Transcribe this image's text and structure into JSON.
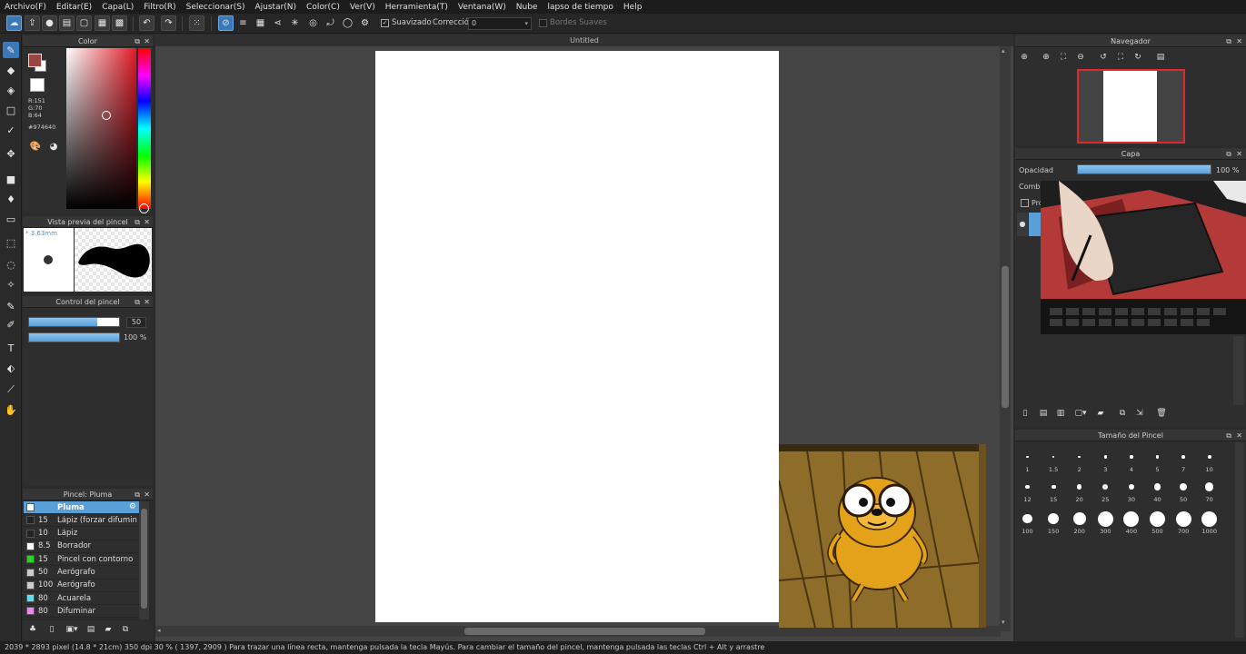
{
  "menu": [
    "Archivo(F)",
    "Editar(E)",
    "Capa(L)",
    "Filtro(R)",
    "Seleccionar(S)",
    "Ajustar(N)",
    "Color(C)",
    "Ver(V)",
    "Herramienta(T)",
    "Ventana(W)",
    "Nube",
    "lapso de tiempo",
    "Help"
  ],
  "toolbar": {
    "smoothing_label": "Suavizado",
    "correction_label": "Corrección",
    "correction_value": "0",
    "soft_edges_label": "Bordes Suaves"
  },
  "color_panel": {
    "title": "Color",
    "r": "R:151",
    "g": "G:70",
    "b": "B:64",
    "hex": "#974640",
    "main_color": "#974640"
  },
  "brush_preview": {
    "title": "Vista previa del pincel",
    "size": "* 3.63mm"
  },
  "brush_control": {
    "title": "Control del pincel",
    "size_value": "50",
    "size_fraction": 0.76,
    "opacity_value": "100 %",
    "opacity_fraction": 1.0
  },
  "brush_list": {
    "title": "Pincel: Pluma",
    "items": [
      {
        "size": "",
        "name": "Pluma",
        "color": "#ffffff",
        "selected": true
      },
      {
        "size": "15",
        "name": "Lápiz (forzar difuminado)",
        "color": "#222222"
      },
      {
        "size": "10",
        "name": "Lápiz",
        "color": "#222222"
      },
      {
        "size": "8.5",
        "name": "Borrador",
        "color": "#ffffff"
      },
      {
        "size": "15",
        "name": "Pincel con contorno",
        "color": "#33cc33"
      },
      {
        "size": "50",
        "name": "Aerógrafo",
        "color": "#cccccc"
      },
      {
        "size": "100",
        "name": "Aerógrafo",
        "color": "#cccccc"
      },
      {
        "size": "80",
        "name": "Acuarela",
        "color": "#66ddee"
      },
      {
        "size": "80",
        "name": "Difuminar",
        "color": "#ee88ee"
      }
    ]
  },
  "document": {
    "tab_title": "Untitled"
  },
  "navigator": {
    "title": "Navegador"
  },
  "layer_panel": {
    "title": "Capa",
    "opacity_label": "Opacidad",
    "opacity_value": "100 %",
    "opacity_fraction": 1.0,
    "blend_label": "Combin",
    "protect_label": "Pro"
  },
  "brush_size_panel": {
    "title": "Tamaño del Pincel",
    "sizes": [
      "1",
      "1.5",
      "2",
      "3",
      "4",
      "5",
      "7",
      "10",
      "12",
      "15",
      "20",
      "25",
      "30",
      "40",
      "50",
      "70",
      "100",
      "150",
      "200",
      "300",
      "400",
      "500",
      "700",
      "1000"
    ]
  },
  "statusbar": {
    "text": "2039 * 2893 pixel  (14.8 * 21cm)  350 dpi  30 %  ( 1397, 2909 )  Para trazar una línea recta, mantenga pulsada la tecla Mayús. Para cambiar el tamaño del pincel, mantenga pulsada las teclas Ctrl + Alt y arrastre"
  },
  "icons": {
    "tools": [
      "pen-icon",
      "eraser-icon",
      "fill-eraser-icon",
      "rectangle-icon",
      "brush-check-icon",
      "move-icon",
      "square-fill-icon",
      "bucket-icon",
      "gradient-icon",
      "select-rect-icon",
      "lasso-icon",
      "magic-wand-icon",
      "select-pen-icon",
      "select-eraser-icon",
      "text-icon",
      "divide-icon",
      "eyedropper-icon",
      "hand-icon"
    ]
  }
}
